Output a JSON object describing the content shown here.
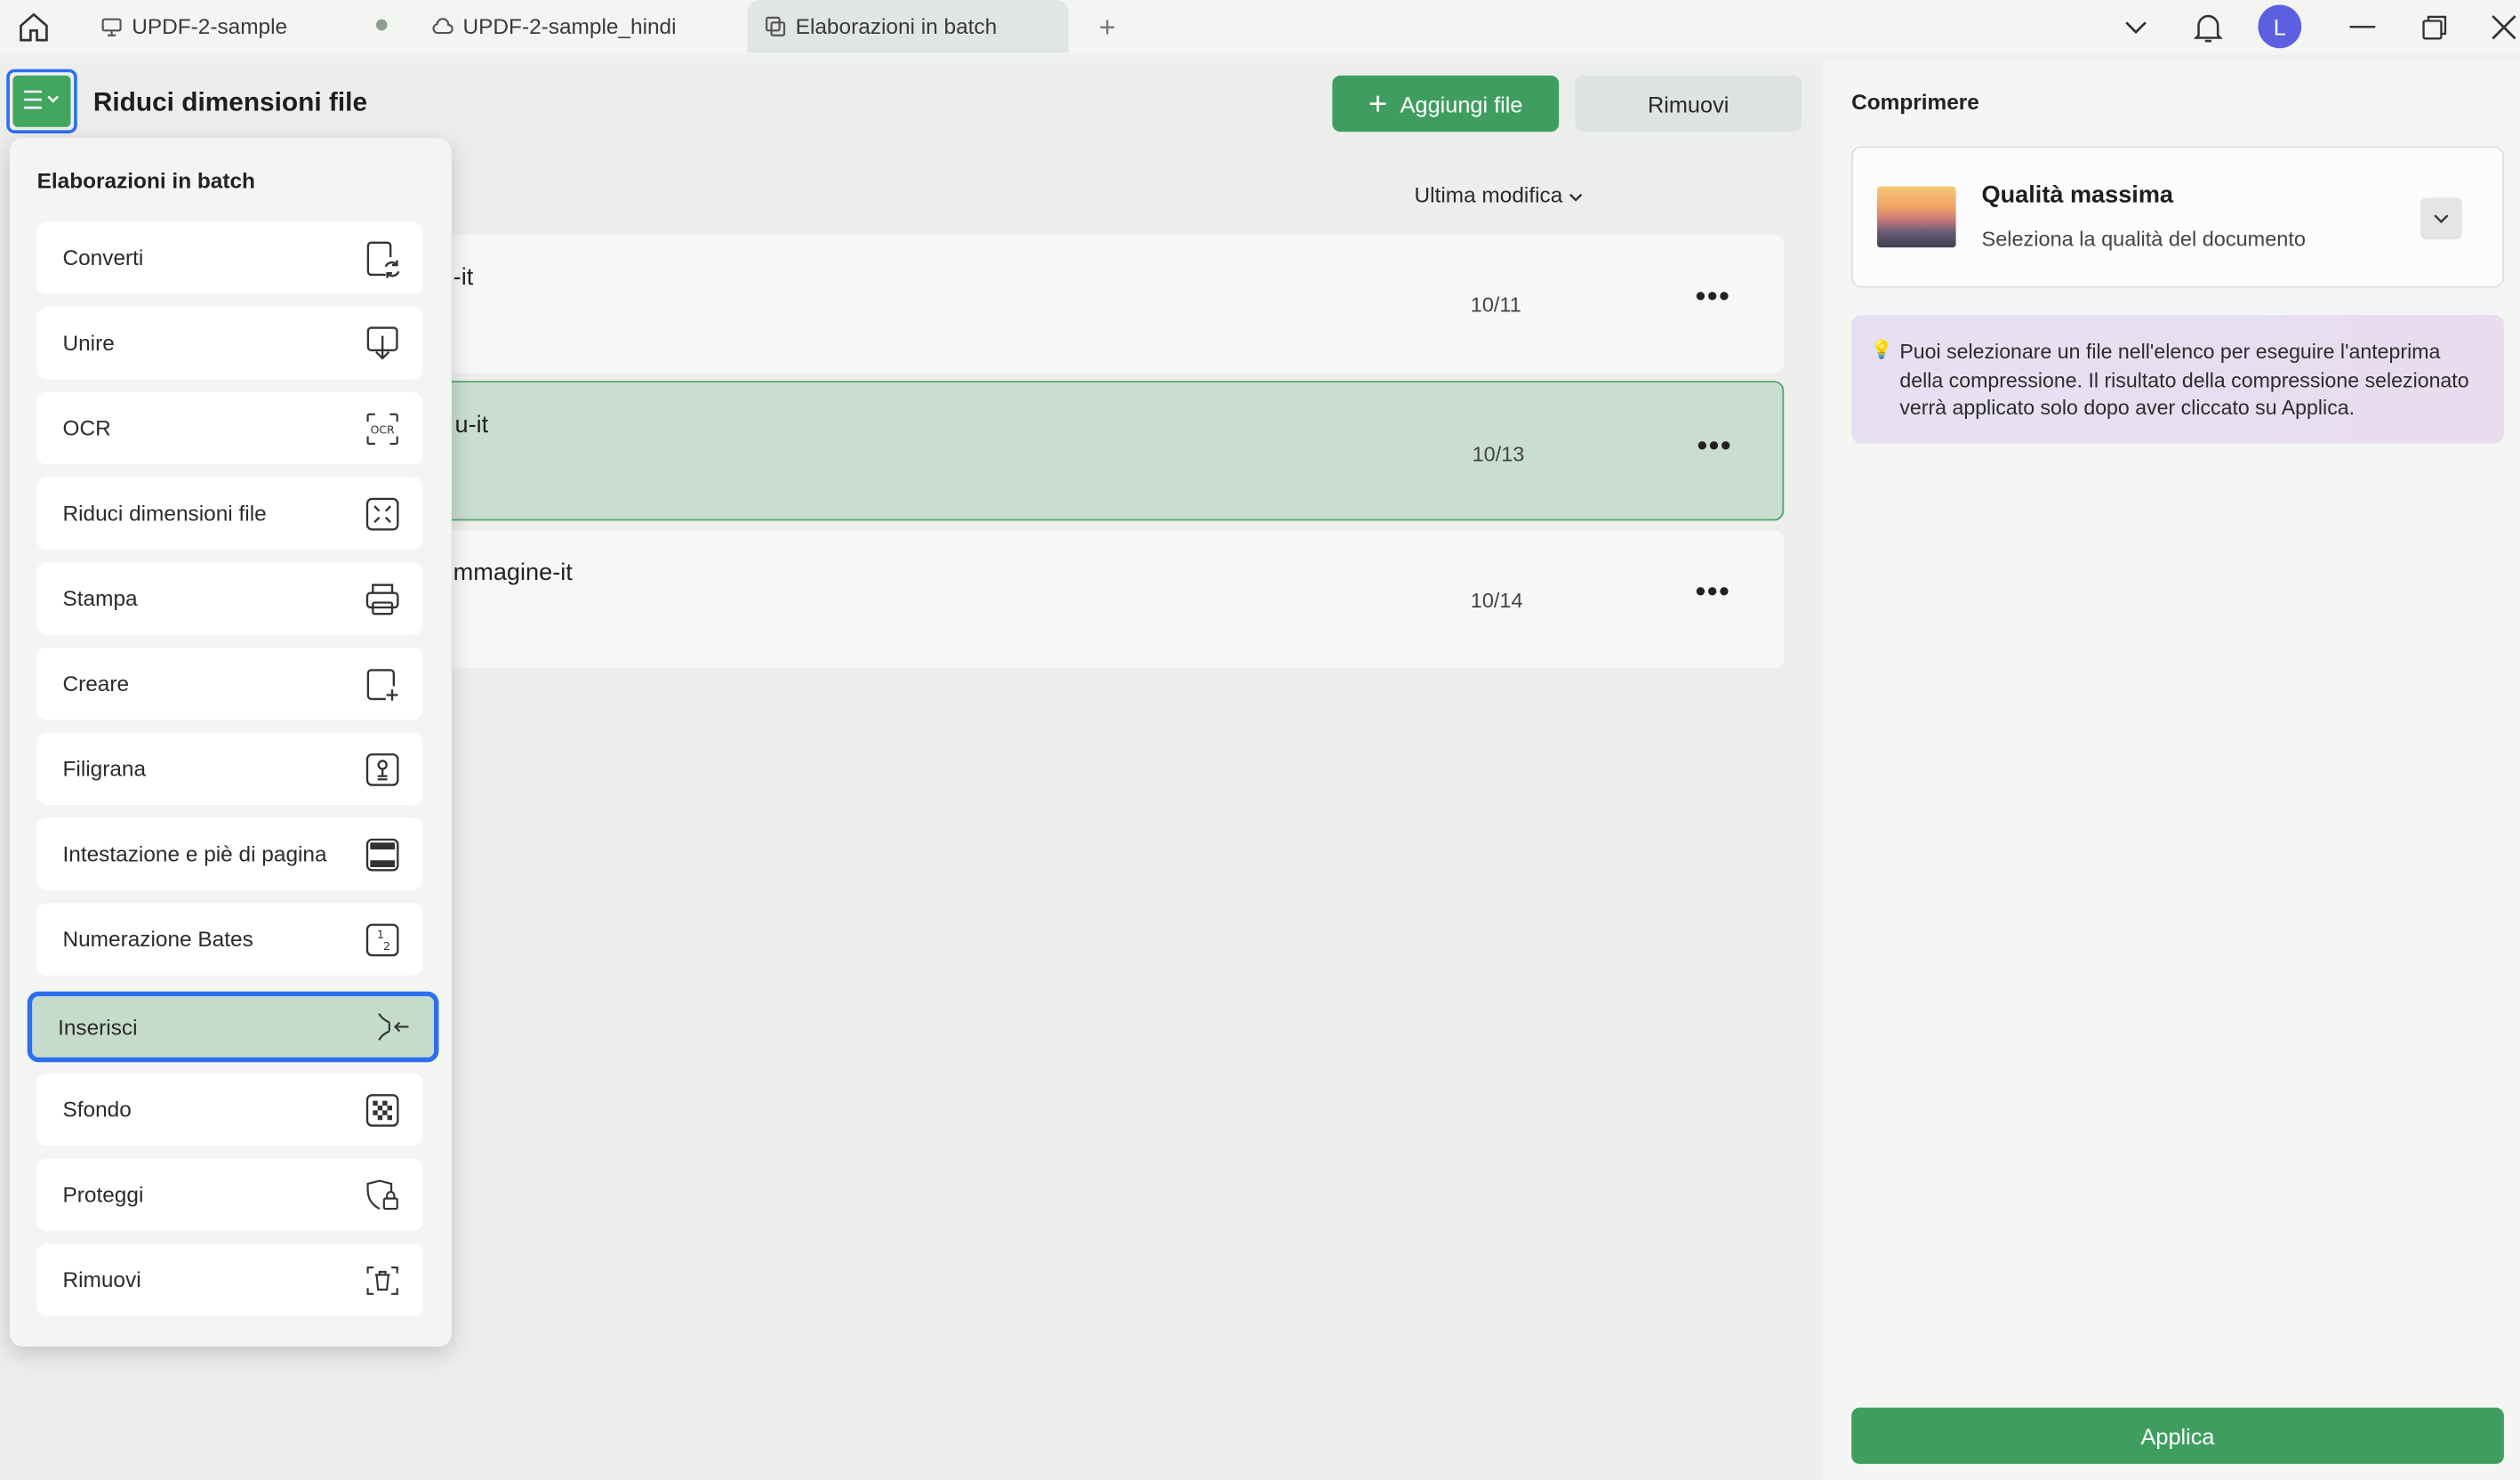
{
  "titlebar": {
    "tabs": [
      {
        "label": "UPDF-2-sample",
        "icon": "monitor-icon"
      },
      {
        "label": "UPDF-2-sample_hindi",
        "icon": "cloud-icon"
      },
      {
        "label": "Elaborazioni in batch",
        "icon": "batch-icon"
      }
    ],
    "avatar_letter": "L"
  },
  "header": {
    "title": "Riduci dimensioni file",
    "add_files_label": "Aggiungi file",
    "remove_label": "Rimuovi"
  },
  "file_list": {
    "sort_label": "Ultima modifica",
    "rows": [
      {
        "name_fragment": "-it",
        "date": "10/11"
      },
      {
        "name_fragment": "u-it",
        "date": "10/13"
      },
      {
        "name_fragment": "mmagine-it",
        "date": "10/14"
      }
    ]
  },
  "dropdown": {
    "title": "Elaborazioni in batch",
    "items": [
      {
        "label": "Converti",
        "icon": "convert-icon"
      },
      {
        "label": "Unire",
        "icon": "merge-icon"
      },
      {
        "label": "OCR",
        "icon": "ocr-icon"
      },
      {
        "label": "Riduci dimensioni file",
        "icon": "compress-icon"
      },
      {
        "label": "Stampa",
        "icon": "print-icon"
      },
      {
        "label": "Creare",
        "icon": "create-icon"
      },
      {
        "label": "Filigrana",
        "icon": "watermark-icon"
      },
      {
        "label": "Intestazione e piè di pagina",
        "icon": "header-footer-icon"
      },
      {
        "label": "Numerazione Bates",
        "icon": "bates-icon"
      },
      {
        "label": "Inserisci",
        "icon": "insert-icon"
      },
      {
        "label": "Sfondo",
        "icon": "background-icon"
      },
      {
        "label": "Proteggi",
        "icon": "protect-icon"
      },
      {
        "label": "Rimuovi",
        "icon": "remove-icon"
      }
    ],
    "highlighted": "Inserisci"
  },
  "compress_panel": {
    "title": "Comprimere",
    "quality_name": "Qualità massima",
    "quality_sub": "Seleziona la qualità del documento",
    "tip": "Puoi selezionare un file nell'elenco per eseguire l'anteprima della compressione. Il risultato della compressione selezionato verrà applicato solo dopo aver cliccato su Applica.",
    "apply_label": "Applica"
  },
  "colors": {
    "accent_green": "#3f9e5f",
    "highlight_blue": "#2d6ef0",
    "selected_row": "#c9ddd0"
  }
}
